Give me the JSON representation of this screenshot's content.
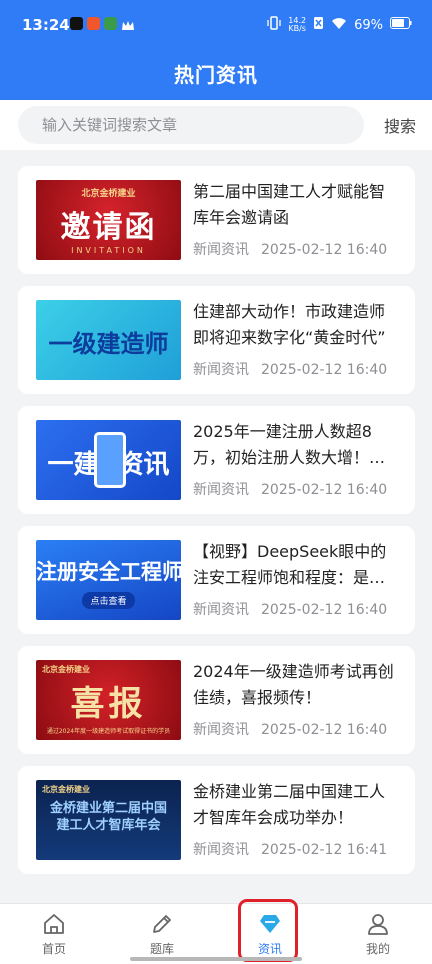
{
  "status_bar": {
    "time": "13:24",
    "net_speed_top": "14.2",
    "net_speed_bottom": "KB/s",
    "battery": "69%"
  },
  "header": {
    "title": "热门资讯"
  },
  "search": {
    "placeholder": "输入关键词搜索文章",
    "button_label": "搜索"
  },
  "articles": [
    {
      "title": "第二届中国建工人才赋能智库年会邀请函",
      "category": "新闻资讯",
      "date": "2025-02-12 16:40",
      "thumb_text": "邀请函",
      "thumb_sub": "INVITATION",
      "thumb_brand": "北京金桥建业",
      "thumb_color": "#b5121b"
    },
    {
      "title": "住建部大动作！市政建造师即将迎来数字化“黄金时代”",
      "category": "新闻资讯",
      "date": "2025-02-12 16:40",
      "thumb_text": "一级建造师",
      "thumb_color": "#27b5df"
    },
    {
      "title": "2025年一建注册人数超8万，初始注册人数大增！…",
      "category": "新闻资讯",
      "date": "2025-02-12 16:40",
      "thumb_text": "一建  资讯",
      "thumb_color": "#1f5fe0"
    },
    {
      "title": "【视野】DeepSeek眼中的注安工程师饱和程度：是…",
      "category": "新闻资讯",
      "date": "2025-02-12 16:40",
      "thumb_text": "注册安全工程师",
      "thumb_sub": "点击查看",
      "thumb_color": "#1e63e6"
    },
    {
      "title": "2024年一级建造师考试再创佳绩，喜报频传！",
      "category": "新闻资讯",
      "date": "2025-02-12 16:40",
      "thumb_text": "喜报",
      "thumb_sub": "通过2024年度一级建造师考试取得证书的学员",
      "thumb_brand": "北京金桥建业",
      "thumb_color": "#b8141c"
    },
    {
      "title": "金桥建业第二届中国建工人才智库年会成功举办！",
      "category": "新闻资讯",
      "date": "2025-02-12 16:41",
      "thumb_text": "金桥建业第二届中国建工人才智库年会",
      "thumb_brand": "北京金桥建业",
      "thumb_color": "#0d2a63"
    }
  ],
  "tabs": [
    {
      "label": "首页",
      "icon": "home-icon"
    },
    {
      "label": "题库",
      "icon": "pencil-icon"
    },
    {
      "label": "资讯",
      "icon": "diamond-icon",
      "active": true
    },
    {
      "label": "我的",
      "icon": "user-icon"
    }
  ],
  "colors": {
    "primary": "#2f7cf6",
    "highlight": "#e0202b"
  }
}
